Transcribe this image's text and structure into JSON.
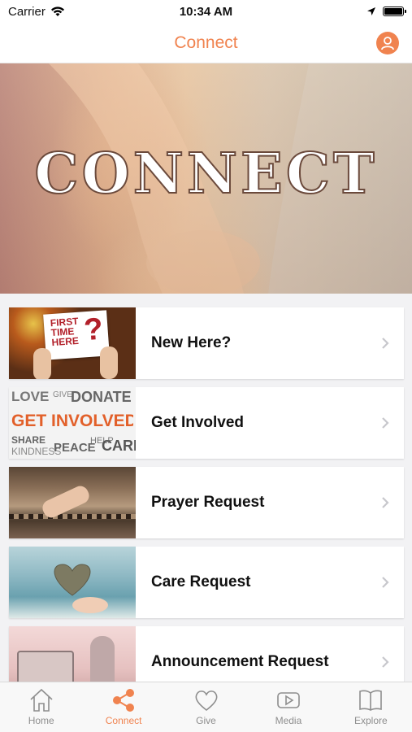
{
  "status": {
    "carrier": "Carrier",
    "time": "10:34 AM"
  },
  "nav": {
    "title": "Connect"
  },
  "hero": {
    "title": "CONNECT"
  },
  "items": [
    {
      "label": "New Here?",
      "thumb_text": [
        "FIRST",
        "TIME",
        "HERE",
        "?"
      ]
    },
    {
      "label": "Get Involved",
      "thumb_text": [
        "LOVE",
        "GIVE",
        "DONATE",
        "GET INVOLVED",
        "SHARE",
        "KINDNESS",
        "PEACE",
        "HELP",
        "CARE"
      ]
    },
    {
      "label": "Prayer Request"
    },
    {
      "label": "Care Request"
    },
    {
      "label": "Announcement Request"
    }
  ],
  "tabs": [
    {
      "label": "Home",
      "icon": "home-icon",
      "active": false
    },
    {
      "label": "Connect",
      "icon": "share-icon",
      "active": true
    },
    {
      "label": "Give",
      "icon": "heart-icon",
      "active": false
    },
    {
      "label": "Media",
      "icon": "play-icon",
      "active": false
    },
    {
      "label": "Explore",
      "icon": "book-icon",
      "active": false
    }
  ],
  "colors": {
    "accent": "#f0834f",
    "inactive": "#8e8e8e"
  }
}
